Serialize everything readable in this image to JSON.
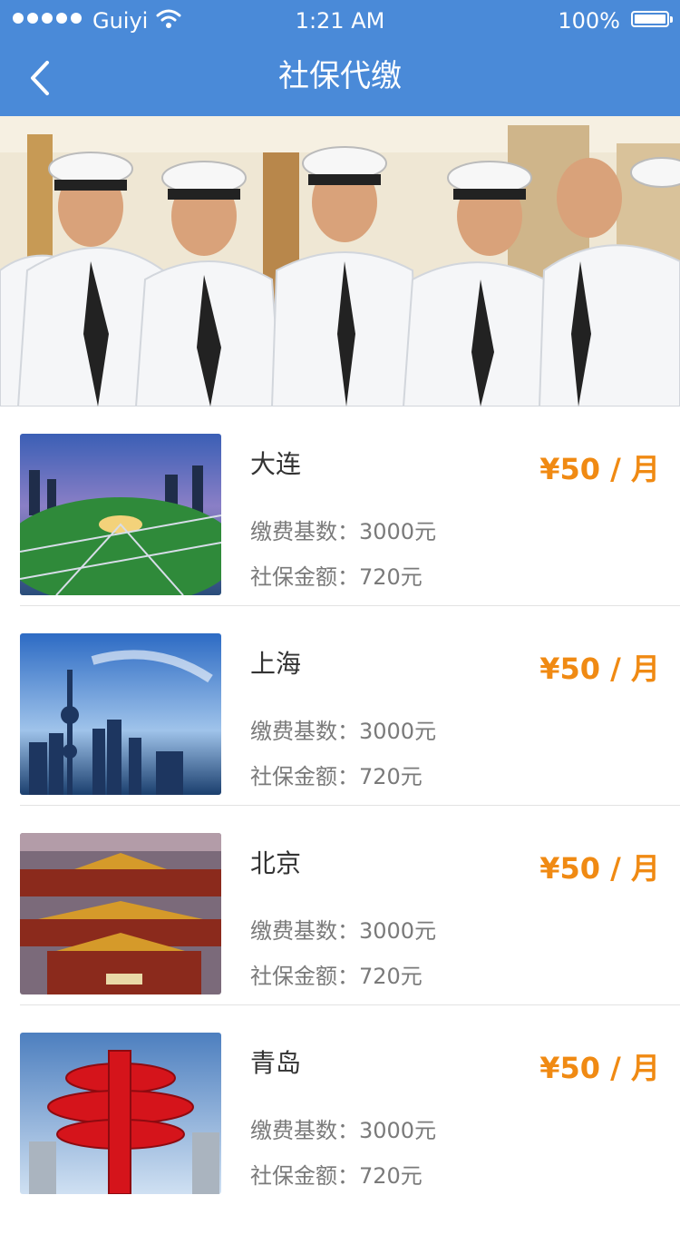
{
  "status_bar": {
    "carrier": "Guiyi",
    "time": "1:21 AM",
    "battery": "100%"
  },
  "nav": {
    "title": "社保代缴",
    "back_icon": "chevron-left-icon"
  },
  "banner": {
    "description_icon": "group-photo"
  },
  "items": [
    {
      "city": "大连",
      "price": "¥50 / 月",
      "base_label": "缴费基数：",
      "base_value": "3000元",
      "amount_label": "社保金额：",
      "amount_value": "720元"
    },
    {
      "city": "上海",
      "price": "¥50 / 月",
      "base_label": "缴费基数：",
      "base_value": "3000元",
      "amount_label": "社保金额：",
      "amount_value": "720元"
    },
    {
      "city": "北京",
      "price": "¥50 / 月",
      "base_label": "缴费基数：",
      "base_value": "3000元",
      "amount_label": "社保金额：",
      "amount_value": "720元"
    },
    {
      "city": "青岛",
      "price": "¥50 / 月",
      "base_label": "缴费基数：",
      "base_value": "3000元",
      "amount_label": "社保金额：",
      "amount_value": "720元"
    }
  ],
  "colors": {
    "header": "#4a8ad8",
    "price": "#f08a13",
    "muted": "#7a7a7a"
  }
}
